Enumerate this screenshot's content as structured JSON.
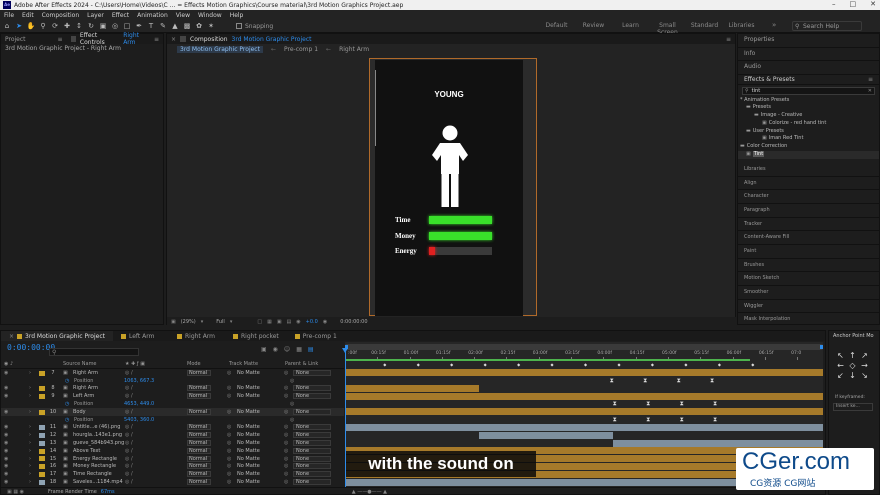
{
  "window": {
    "title": "Adobe After Effects 2024 - C:\\Users\\Home\\Videos\\C ... = Effects Motion Graphics\\Course material\\3rd Motion Graphics Project.aep",
    "app_icon": "Ae"
  },
  "menu": [
    "File",
    "Edit",
    "Composition",
    "Layer",
    "Effect",
    "Animation",
    "View",
    "Window",
    "Help"
  ],
  "toolbar": {
    "snapping_label": "Snapping",
    "workspaces": [
      "Default",
      "Review",
      "Learn",
      "Small Screen",
      "Standard",
      "Libraries"
    ],
    "search_placeholder": "Search Help"
  },
  "project_panel": {
    "tab_project": "Project",
    "tab_effect_controls": "Effect Controls",
    "effect_controls_layer": "Right Arm",
    "breadcrumb": "3rd Motion Graphic Project - Right Arm"
  },
  "composition_panel": {
    "tab_label": "Composition",
    "comp_name": "3rd Motion Graphic Project",
    "subtabs": [
      "3rd Motion Graphic Project",
      "Pre-comp 1",
      "Right Arm"
    ],
    "zoom": "(29%)",
    "resolution": "Full",
    "exposure": "+0.0",
    "timecode": "0:00:00:00"
  },
  "preview": {
    "heading": "YOUNG",
    "bars": [
      {
        "label": "Time",
        "fill": 1.0,
        "color": "#39e02a"
      },
      {
        "label": "Money",
        "fill": 1.0,
        "color": "#39e02a"
      },
      {
        "label": "Energy",
        "fill": 0.1,
        "color": "#e02020"
      }
    ]
  },
  "right_panel": {
    "top_sections": [
      "Properties",
      "Info",
      "Audio"
    ],
    "effects_title": "Effects & Presets",
    "search_value": "tint",
    "tree": [
      "* Animation Presets",
      "Presets",
      "Image - Creative",
      "Colorize - red hand tint",
      "User Presets",
      "Iman Red Tint",
      "Color Correction",
      "Tint"
    ],
    "sections": [
      "Libraries",
      "Align",
      "Character",
      "Paragraph",
      "Tracker",
      "Content-Aware Fill",
      "Paint",
      "Brushes",
      "Motion Sketch",
      "Smoother",
      "Wiggler",
      "Mask Interpolation"
    ]
  },
  "timeline": {
    "tabs": [
      "3rd Motion Graphic Project",
      "Left Arm",
      "Right Arm",
      "Right pocket",
      "Pre-comp 1"
    ],
    "timecode": "0:00:00:00",
    "columns": {
      "source": "Source Name",
      "mode": "Mode",
      "track": "Track Matte",
      "parent": "Parent & Link"
    },
    "ruler": [
      ":00f",
      "00:15f",
      "01:00f",
      "01:15f",
      "02:00f",
      "02:15f",
      "03:00f",
      "03:15f",
      "04:00f",
      "04:15f",
      "05:00f",
      "05:15f",
      "06:00f",
      "06:15f",
      "07:0"
    ],
    "layers": [
      {
        "idx": "7",
        "name": "Right Arm",
        "color": "#c9a227",
        "mode": "Normal",
        "matte": "No Matte",
        "parent": "None"
      },
      {
        "prop": "Position",
        "value": "1063, 667.3"
      },
      {
        "idx": "8",
        "name": "Right Arm",
        "color": "#c9a227",
        "mode": "Normal",
        "matte": "No Matte",
        "parent": "None"
      },
      {
        "idx": "9",
        "name": "Left Arm",
        "color": "#c9a227",
        "mode": "Normal",
        "matte": "No Matte",
        "parent": "None"
      },
      {
        "prop": "Position",
        "value": "4653, 449.0"
      },
      {
        "idx": "10",
        "name": "Body",
        "color": "#c9a227",
        "mode": "Normal",
        "matte": "No Matte",
        "parent": "None"
      },
      {
        "prop": "Position",
        "value": "5403, 360.0"
      },
      {
        "idx": "11",
        "name": "Untitle...e (46).png",
        "color": "#8fa3b3",
        "mode": "Normal",
        "matte": "No Matte",
        "parent": "None"
      },
      {
        "idx": "12",
        "name": "hourgla..143e1.png",
        "color": "#8fa3b3",
        "mode": "Normal",
        "matte": "No Matte",
        "parent": "None"
      },
      {
        "idx": "13",
        "name": "gueve_584b943.png",
        "color": "#8fa3b3",
        "mode": "Normal",
        "matte": "No Matte",
        "parent": "None"
      },
      {
        "idx": "14",
        "name": "Above Text",
        "color": "#c9a227",
        "mode": "Normal",
        "matte": "No Matte",
        "parent": "None"
      },
      {
        "idx": "15",
        "name": "Energy Rectangle",
        "color": "#c9a227",
        "mode": "Normal",
        "matte": "No Matte",
        "parent": "None"
      },
      {
        "idx": "16",
        "name": "Money Rectangle",
        "color": "#c9a227",
        "mode": "Normal",
        "matte": "No Matte",
        "parent": "None"
      },
      {
        "idx": "17",
        "name": "Time Rectangle",
        "color": "#c9a227",
        "mode": "Normal",
        "matte": "No Matte",
        "parent": "None"
      },
      {
        "idx": "18",
        "name": "Saveles...1184.mp4",
        "color": "#8fa3b3",
        "mode": "Normal",
        "matte": "No Matte",
        "parent": "None"
      }
    ],
    "footer_label": "Frame Render Time",
    "footer_value": "67ms"
  },
  "anchor_panel": {
    "title": "Anchor Point Mo",
    "if_keyframed": "If keyframed:",
    "insert_value": "Insert ke..."
  },
  "subtitle": "with the sound on",
  "watermark": {
    "main": "CGer.com",
    "sub": "CG资源  CG网站"
  }
}
